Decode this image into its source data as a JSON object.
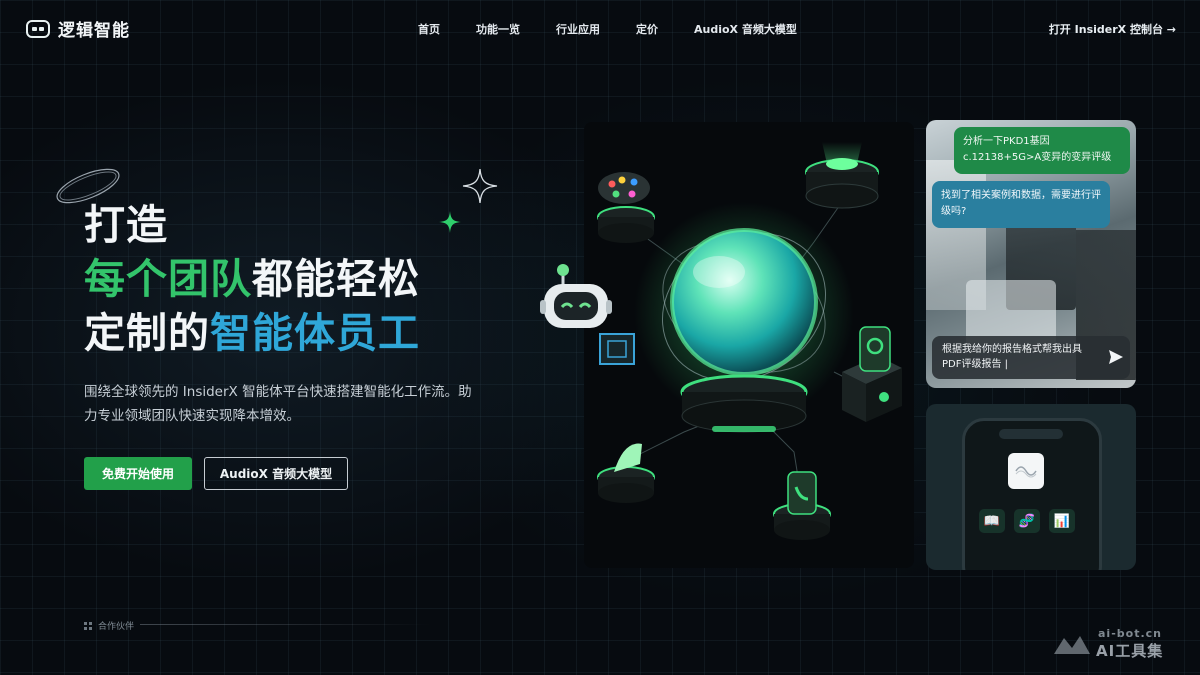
{
  "brand": {
    "name": "逻辑智能"
  },
  "nav": {
    "links": [
      "首页",
      "功能一览",
      "行业应用",
      "定价",
      "AudioX 音频大模型"
    ],
    "cta": "打开 InsiderX 控制台 →"
  },
  "hero": {
    "line1": "打造",
    "line2_green": "每个团队",
    "line2_white": "都能轻松",
    "line3_white": "定制的",
    "line3_blue": "智能体员工",
    "description": "围绕全球领先的 InsiderX 智能体平台快速搭建智能化工作流。助力专业领域团队快速实现降本增效。",
    "primary_button": "免费开始使用",
    "secondary_button": "AudioX 音频大模型"
  },
  "chat": {
    "user_message": "分析一下PKD1基因c.12138+5G>A变异的变异评级",
    "assistant_message": "找到了相关案例和数据，需要进行评级吗?",
    "input_text": "根据我给你的报告格式帮我出具PDF评级报告 |"
  },
  "phone": {
    "tiles": [
      "📖",
      "🧬",
      "📊"
    ]
  },
  "partners": {
    "label": "合作伙伴"
  },
  "watermark": {
    "top": "ai-bot.cn",
    "bottom": "AI工具集"
  },
  "colors": {
    "accent_green": "#33c46b",
    "accent_blue": "#2fa7d8",
    "button_green": "#22a04a",
    "background": "#070b10"
  }
}
